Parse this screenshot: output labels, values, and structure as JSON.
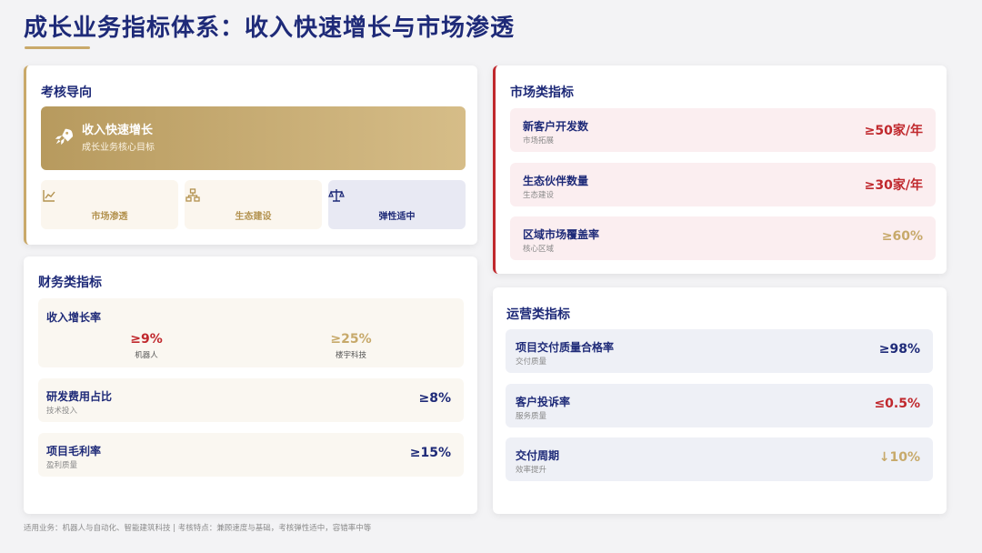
{
  "page": {
    "title": "成长业务指标体系：收入快速增长与市场渗透",
    "footer": "适用业务：机器人与自动化、智能建筑科技 | 考核特点：兼顾速度与基础，考核弹性适中，容错率中等"
  },
  "colors": {
    "navy": "#1e2a78",
    "gold": "#c9a96a",
    "red": "#c0282d",
    "muted_gold": "#c7a96a"
  },
  "orientation": {
    "title": "考核导向",
    "hero": {
      "icon": "rocket-icon",
      "title": "收入快速增长",
      "subtitle": "成长业务核心目标"
    },
    "tiles": [
      {
        "icon": "line-chart-icon",
        "label": "市场渗透"
      },
      {
        "icon": "network-icon",
        "label": "生态建设"
      },
      {
        "icon": "balance-scale-icon",
        "label": "弹性适中"
      }
    ]
  },
  "finance": {
    "title": "财务类指标",
    "revenue_growth": {
      "name": "收入增长率",
      "items": [
        {
          "value": "≥9%",
          "label": "机器人"
        },
        {
          "value": "≥25%",
          "label": "楼宇科技"
        }
      ]
    },
    "rows": [
      {
        "name": "研发费用占比",
        "sub": "技术投入",
        "value": "≥8%"
      },
      {
        "name": "项目毛利率",
        "sub": "盈利质量",
        "value": "≥15%"
      }
    ]
  },
  "market": {
    "title": "市场类指标",
    "rows": [
      {
        "name": "新客户开发数",
        "sub": "市场拓展",
        "value": "≥50家/年"
      },
      {
        "name": "生态伙伴数量",
        "sub": "生态建设",
        "value": "≥30家/年"
      },
      {
        "name": "区域市场覆盖率",
        "sub": "核心区域",
        "value": "≥60%"
      }
    ]
  },
  "operations": {
    "title": "运营类指标",
    "rows": [
      {
        "name": "项目交付质量合格率",
        "sub": "交付质量",
        "value": "≥98%"
      },
      {
        "name": "客户投诉率",
        "sub": "服务质量",
        "value": "≤0.5%"
      },
      {
        "name": "交付周期",
        "sub": "效率提升",
        "value": "↓10%"
      }
    ]
  }
}
